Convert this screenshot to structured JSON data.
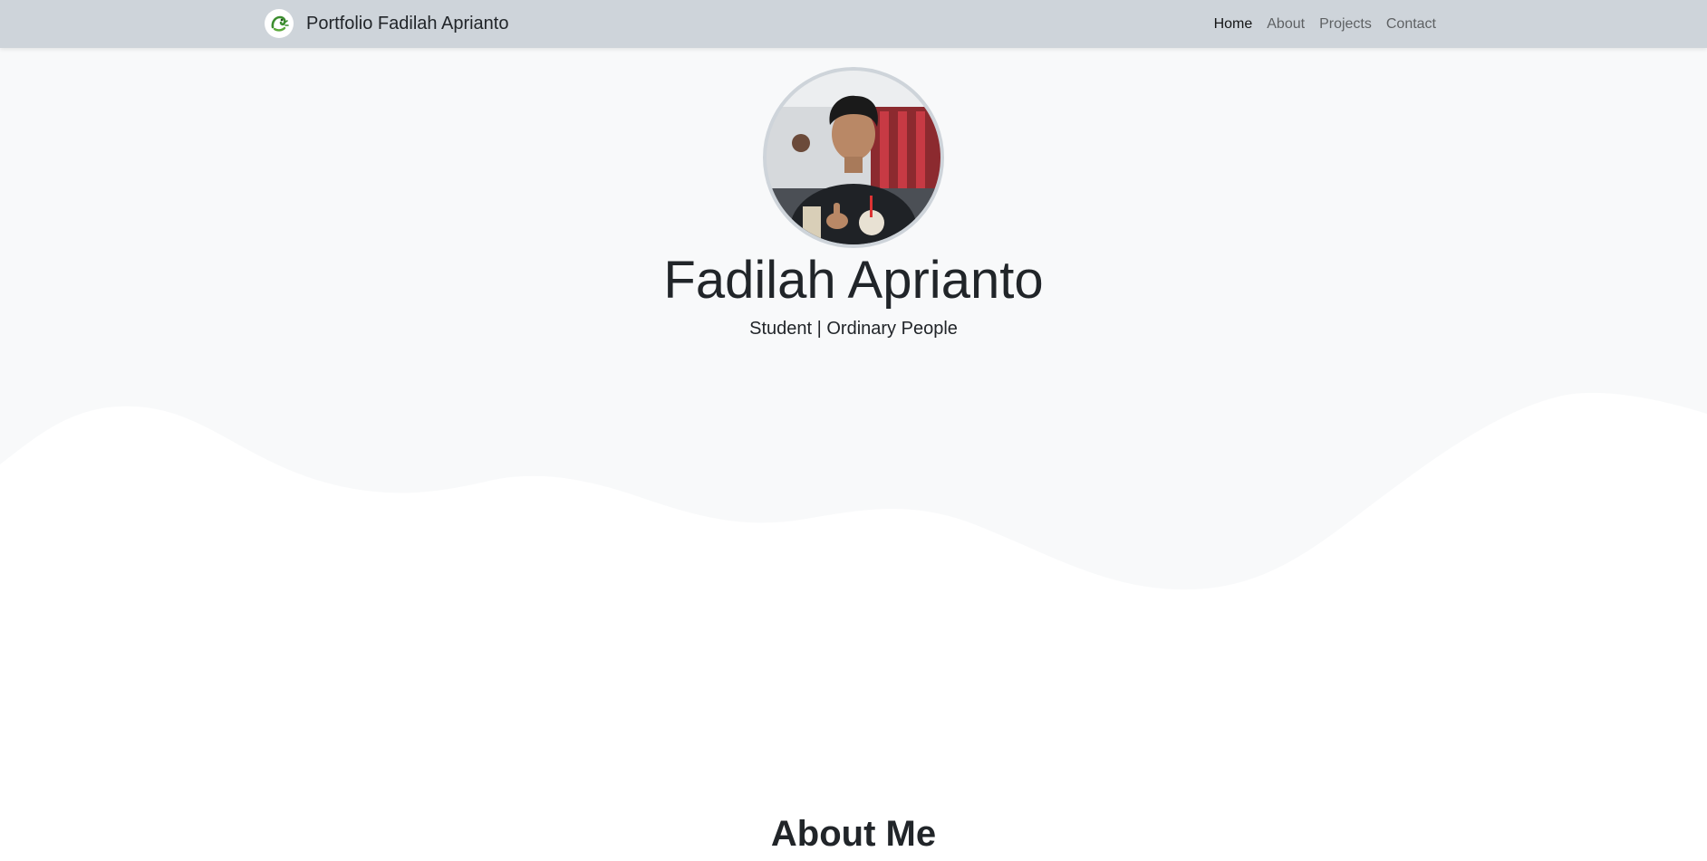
{
  "navbar": {
    "brand_text": "Portfolio Fadilah Aprianto",
    "brand_icon": "dragon-logo-icon",
    "links": [
      {
        "label": "Home",
        "active": true
      },
      {
        "label": "About",
        "active": false
      },
      {
        "label": "Projects",
        "active": false
      },
      {
        "label": "Contact",
        "active": false
      }
    ]
  },
  "hero": {
    "name": "Fadilah Aprianto",
    "tagline": "Student | Ordinary People",
    "avatar_icon": "profile-photo"
  },
  "about": {
    "heading": "About Me"
  },
  "colors": {
    "navbar_bg": "#ced4da",
    "hero_bg": "#f8f9fa",
    "avatar_border": "#ced4da",
    "text": "#212529"
  }
}
